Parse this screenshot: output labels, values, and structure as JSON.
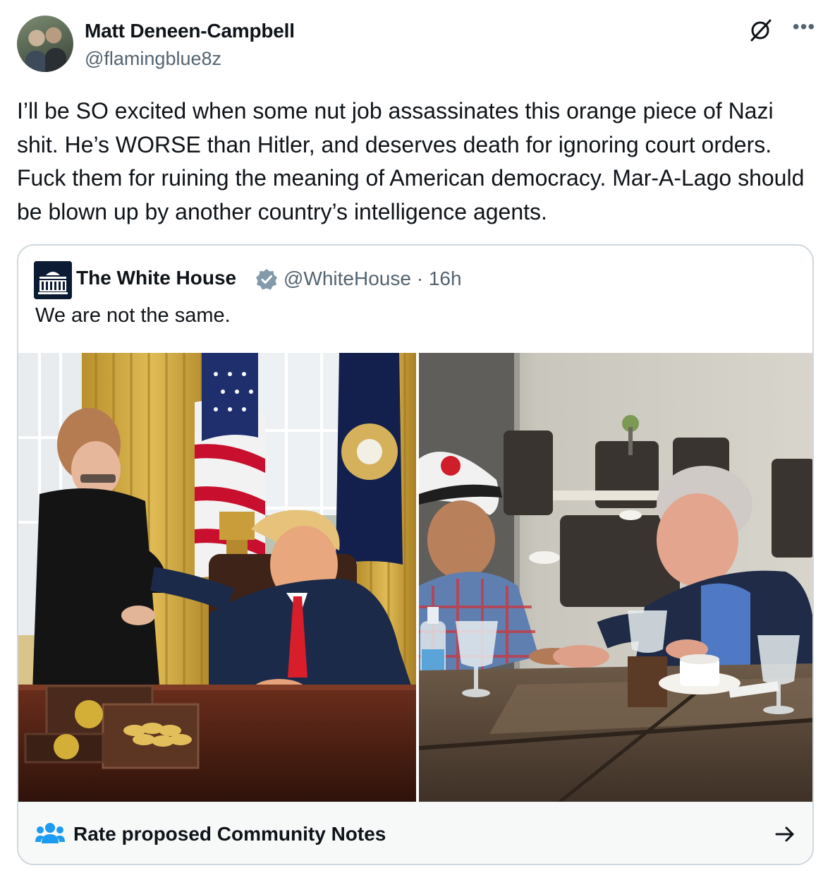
{
  "tweet": {
    "author_name": "Matt Deneen-Campbell",
    "author_handle": "@flamingblue8z",
    "text": "I’ll be SO excited when some nut job assassinates this orange piece of Nazi shit. He’s WORSE than Hitler, and deserves death for ignoring court orders. Fuck them for ruining the meaning of American democracy. Mar-A-Lago should be blown up by another country’s intelligence agents.",
    "icons": [
      "grok-icon",
      "more-icon"
    ]
  },
  "quote": {
    "author_name": "The White House",
    "author_handle": "@WhiteHouse",
    "separator": "·",
    "time": "16h",
    "verified_color": "#829aab",
    "text": "We are not the same.",
    "images": [
      {
        "name": "oval-office-photo"
      },
      {
        "name": "restaurant-meeting-photo"
      }
    ]
  },
  "community_notes": {
    "label": "Rate proposed Community Notes",
    "icon": "people-icon",
    "accent": "#1d9bf0",
    "action_icon": "arrow-right-icon"
  }
}
